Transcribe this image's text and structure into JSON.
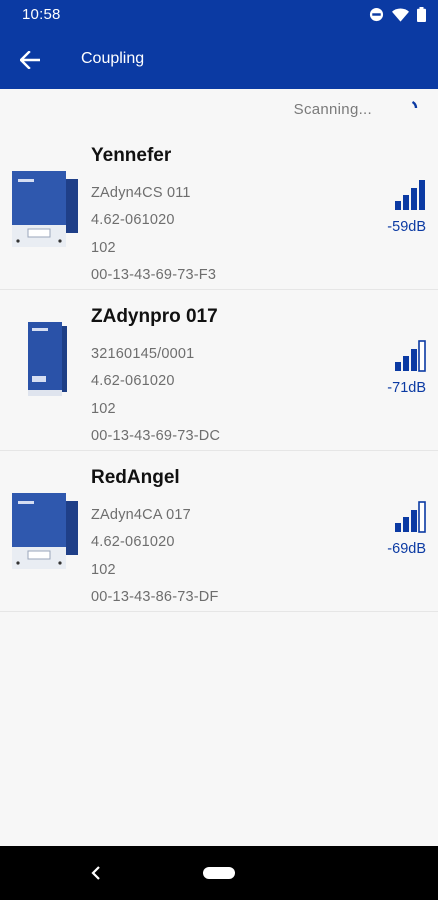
{
  "status_bar": {
    "time": "10:58",
    "icons": [
      "dnd-icon",
      "wifi-icon",
      "battery-icon"
    ]
  },
  "app_bar": {
    "title": "Coupling",
    "back_icon": "arrow-back-icon"
  },
  "scan": {
    "text": "Scanning...",
    "icon": "spinner-icon"
  },
  "devices": [
    {
      "name": "Yennefer",
      "model": "ZAdyn4CS 011",
      "version": "4.62-061020",
      "code": "102",
      "mac": "00-13-43-69-73-F3",
      "signal_db": "-59dB",
      "signal_bars_filled": 4
    },
    {
      "name": "ZAdynpro 017",
      "model": "32160145/0001",
      "version": "4.62-061020",
      "code": "102",
      "mac": "00-13-43-69-73-DC",
      "signal_db": "-71dB",
      "signal_bars_filled": 3
    },
    {
      "name": "RedAngel",
      "model": "ZAdyn4CA 017",
      "version": "4.62-061020",
      "code": "102",
      "mac": "00-13-43-86-73-DF",
      "signal_db": "-69dB",
      "signal_bars_filled": 3
    }
  ],
  "colors": {
    "primary": "#0b3aa3",
    "background": "#f7f7f7",
    "secondary_text": "#6e6e6e"
  },
  "nav_bar": {
    "back_icon": "nav-back-icon",
    "home_icon": "nav-home-pill"
  }
}
